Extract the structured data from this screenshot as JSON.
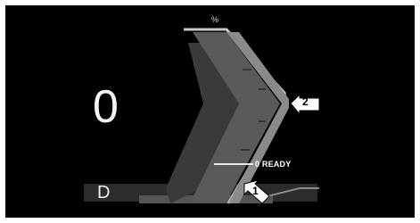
{
  "display": {
    "speed": "0",
    "gear": "D",
    "power_unit": "%",
    "ready_status": "0 READY"
  },
  "callouts": [
    "1",
    "2"
  ],
  "colors": {
    "background": "#000000",
    "gauge_outer": "#8a8a8a",
    "gauge_inner": "#3e3e3e",
    "gauge_highlight": "#c8c8c8",
    "text": "#ffffff",
    "callout_fill": "#ffffff"
  },
  "icons": [
    "chevron-power-gauge",
    "callout-arrow"
  ]
}
